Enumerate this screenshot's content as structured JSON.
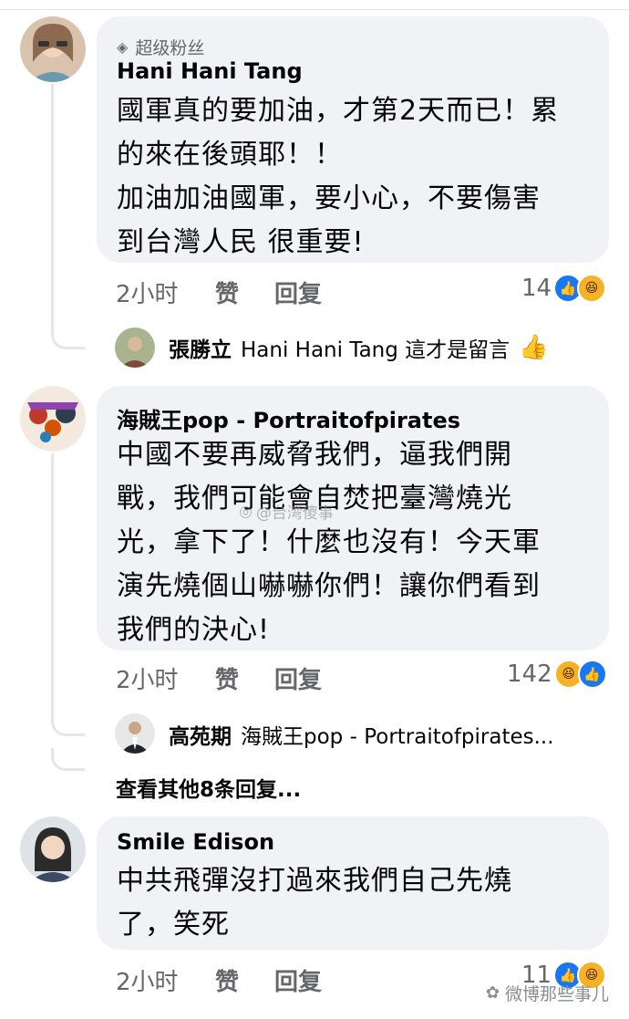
{
  "comments": [
    {
      "badge": "超级粉丝",
      "author": "Hani Hani Tang",
      "lines": [
        "國軍真的要加油，才第2天而已！累",
        "的來在後頭耶！！",
        "加油加油國軍，要小心，不要傷害",
        "到台灣人民 很重要!"
      ],
      "time": "2小时",
      "like_label": "赞",
      "reply_label": "回复",
      "reaction_count": "14",
      "reply": {
        "name": "張勝立",
        "text": "Hani Hani Tang 這才是留言",
        "emoji": "👍"
      }
    },
    {
      "author": "海賊王pop - Portraitofpirates",
      "lines": [
        "中國不要再威脅我們，逼我們開",
        "戰，我們可能會自焚把臺灣燒光",
        "光，拿下了！什麼也沒有！今天軍",
        "演先燒個山嚇嚇你們！讓你們看到",
        "我們的決心!"
      ],
      "time": "2小时",
      "like_label": "赞",
      "reply_label": "回复",
      "reaction_count": "142",
      "reply": {
        "name": "高苑期",
        "text": "海賊王pop - Portraitofpirates..."
      },
      "more_replies": "查看其他8条回复..."
    },
    {
      "author": "Smile Edison",
      "lines": [
        "中共飛彈沒打過來我們自己先燒",
        "了，笑死"
      ],
      "time": "2小时",
      "like_label": "赞",
      "reply_label": "回复",
      "reaction_count": "11"
    }
  ],
  "watermark_mid": "@台湾傻事",
  "watermark_corner": "微博那些事儿",
  "colors": {
    "bubble": "#f0f2f5",
    "secondary_text": "#65676b",
    "like_blue": "#1877f2",
    "haha_yellow": "#f7b125"
  }
}
